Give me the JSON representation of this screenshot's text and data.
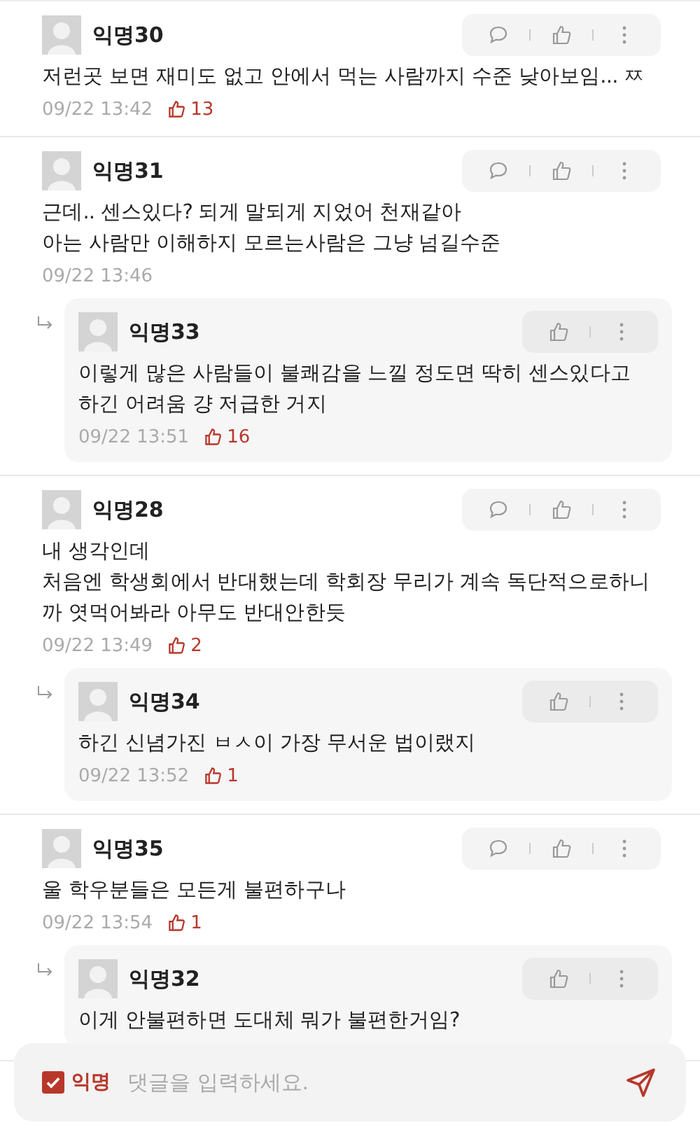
{
  "comments": [
    {
      "author": "익명30",
      "lines": [
        "저런곳 보면 재미도 없고 안에서 먹는 사람까지 수준 낮아보임... ㅉ"
      ],
      "time": "09/22 13:42",
      "likes": "13"
    },
    {
      "author": "익명31",
      "lines": [
        "근데..  센스있다? 되게 말되게 지었어 천재같아",
        "아는 사람만 이해하지 모르는사람은 그냥 넘길수준"
      ],
      "time": "09/22 13:46",
      "replies": [
        {
          "author": "익명33",
          "lines": [
            "이렇게 많은 사람들이 불쾌감을 느낄 정도면 딱히 센스있다고",
            "하긴 어려움 걍 저급한 거지"
          ],
          "time": "09/22 13:51",
          "likes": "16"
        }
      ]
    },
    {
      "author": "익명28",
      "lines": [
        "내 생각인데",
        "처음엔 학생회에서 반대했는데 학회장 무리가 계속 독단적으로하니",
        "까 엿먹어봐라 아무도 반대안한듯"
      ],
      "time": "09/22 13:49",
      "likes": "2",
      "replies": [
        {
          "author": "익명34",
          "lines": [
            "하긴 신념가진 ㅂㅅ이 가장 무서운 법이랬지"
          ],
          "time": "09/22 13:52",
          "likes": "1"
        }
      ]
    },
    {
      "author": "익명35",
      "lines": [
        "울 학우분들은 모든게 불편하구나"
      ],
      "time": "09/22 13:54",
      "likes": "1",
      "replies": [
        {
          "author": "익명32",
          "lines": [
            "이게 안불편하면 도대체 뭐가 불편한거임?"
          ]
        }
      ]
    }
  ],
  "composer": {
    "anonymous_label": "익명",
    "anonymous_checked": true,
    "placeholder": "댓글을 입력하세요."
  }
}
